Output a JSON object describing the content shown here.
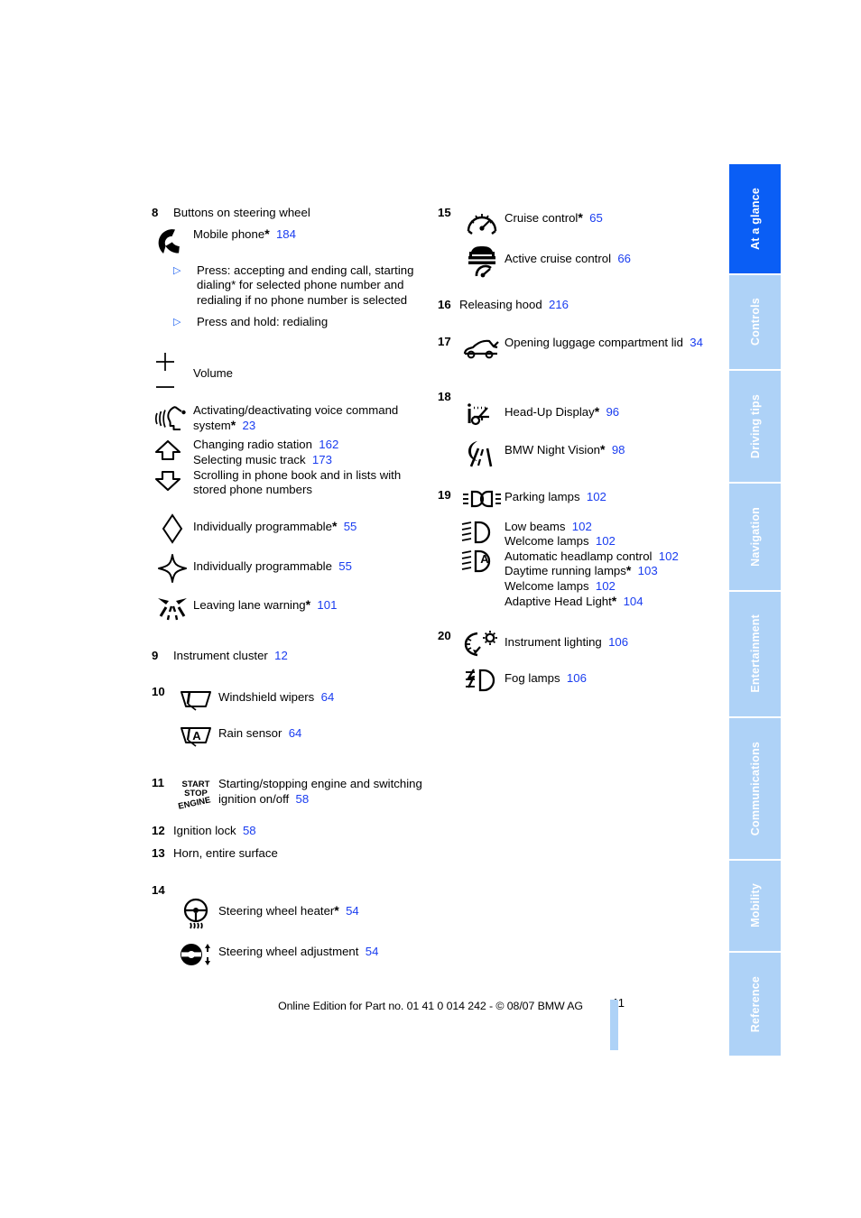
{
  "page": {
    "number": "11",
    "footer_text": "Online Edition for Part no. 01 41 0 014 242 - © 08/07 BMW AG",
    "accent_color": "#1a3df0",
    "tab_active_color": "#0a5ef5",
    "tab_inactive_color": "#aed2f7"
  },
  "tabs": [
    {
      "label": "At a glance",
      "active": true
    },
    {
      "label": "Controls",
      "active": false
    },
    {
      "label": "Driving tips",
      "active": false
    },
    {
      "label": "Navigation",
      "active": false
    },
    {
      "label": "Entertainment",
      "active": false
    },
    {
      "label": "Communications",
      "active": false
    },
    {
      "label": "Mobility",
      "active": false
    },
    {
      "label": "Reference",
      "active": false
    }
  ],
  "left_column": {
    "item8": {
      "number": "8",
      "title": "Buttons on steering wheel",
      "phone": {
        "icon": "phone-handset-icon",
        "label": "Mobile phone",
        "asterisk": "*",
        "page": "184"
      },
      "bullets": [
        "Press: accepting and ending call, starting dialing* for selected phone number and redialing if no phone number is selected",
        "Press and hold: redialing"
      ],
      "volume": {
        "icon_plus": "plus-icon",
        "icon_minus": "minus-icon",
        "label": "Volume"
      },
      "voice": {
        "icon": "voice-command-icon",
        "label": "Activating/deactivating voice command system",
        "asterisk": "*",
        "page": "23"
      },
      "updown": {
        "icon_up": "arrow-up-icon",
        "icon_down": "arrow-down-icon",
        "lines": [
          {
            "label": "Changing radio station",
            "page": "162"
          },
          {
            "label": "Selecting music track",
            "page": "173"
          },
          {
            "label": "Scrolling in phone book and in lists with stored phone numbers",
            "page": ""
          }
        ]
      },
      "prog_diamond": {
        "icon": "diamond-icon",
        "label": "Individually programmable",
        "asterisk": "*",
        "page": "55"
      },
      "prog_star": {
        "icon": "star-four-point-icon",
        "label": "Individually programmable",
        "asterisk": "",
        "page": "55"
      },
      "lane": {
        "icon": "lane-departure-icon",
        "label": "Leaving lane warning",
        "asterisk": "*",
        "page": "101"
      }
    },
    "item9": {
      "number": "9",
      "label": "Instrument cluster",
      "page": "12"
    },
    "item10": {
      "number": "10",
      "wipers": {
        "icon": "windshield-wiper-icon",
        "label": "Windshield wipers",
        "page": "64"
      },
      "rain": {
        "icon": "rain-sensor-icon",
        "label": "Rain sensor",
        "page": "64"
      }
    },
    "item11": {
      "number": "11",
      "icon": "start-stop-engine-icon",
      "icon_text": {
        "line1": "START",
        "line2": "STOP",
        "line3": "ENGINE"
      },
      "label": "Starting/stopping engine and switching ignition on/off",
      "page": "58"
    },
    "item12": {
      "number": "12",
      "label": "Ignition lock",
      "page": "58"
    },
    "item13": {
      "number": "13",
      "label": "Horn, entire surface",
      "page": ""
    },
    "item14": {
      "number": "14",
      "heater": {
        "icon": "steering-wheel-heater-icon",
        "label": "Steering wheel heater",
        "asterisk": "*",
        "page": "54"
      },
      "adjust": {
        "icon": "steering-wheel-adjustment-icon",
        "label": "Steering wheel adjustment",
        "page": "54"
      }
    }
  },
  "right_column": {
    "item15": {
      "number": "15",
      "cruise": {
        "icon": "speedometer-icon",
        "label": "Cruise control",
        "asterisk": "*",
        "page": "65"
      },
      "active_cruise": {
        "icon": "active-cruise-control-icon",
        "label": "Active cruise control",
        "page": "66"
      }
    },
    "item16": {
      "number": "16",
      "label": "Releasing hood",
      "page": "216"
    },
    "item17": {
      "number": "17",
      "icon": "trunk-lid-icon",
      "label": "Opening luggage compartment lid",
      "page": "34"
    },
    "item18": {
      "number": "18",
      "hud": {
        "icon": "head-up-display-icon",
        "label": "Head-Up Display",
        "asterisk": "*",
        "page": "96"
      },
      "night": {
        "icon": "night-vision-icon",
        "label": "BMW Night Vision",
        "asterisk": "*",
        "page": "98"
      }
    },
    "item19": {
      "number": "19",
      "parking": {
        "icon": "parking-lamps-icon",
        "label": "Parking lamps",
        "page": "102"
      },
      "lowbeam_icon": "low-beams-icon",
      "auto_icon": "automatic-headlamp-icon",
      "lines": [
        {
          "label": "Low beams",
          "asterisk": "",
          "page": "102"
        },
        {
          "label": "Welcome lamps",
          "asterisk": "",
          "page": "102"
        },
        {
          "label": "Automatic headlamp control",
          "asterisk": "",
          "page": "102"
        },
        {
          "label": "Daytime running lamps",
          "asterisk": "*",
          "page": "103"
        },
        {
          "label": "Welcome lamps",
          "asterisk": "",
          "page": "102"
        },
        {
          "label": "Adaptive Head Light",
          "asterisk": "*",
          "page": "104"
        }
      ]
    },
    "item20": {
      "number": "20",
      "instrument": {
        "icon": "instrument-lighting-icon",
        "label": "Instrument lighting",
        "page": "106"
      },
      "fog": {
        "icon": "fog-lamps-icon",
        "label": "Fog lamps",
        "page": "106"
      }
    }
  }
}
